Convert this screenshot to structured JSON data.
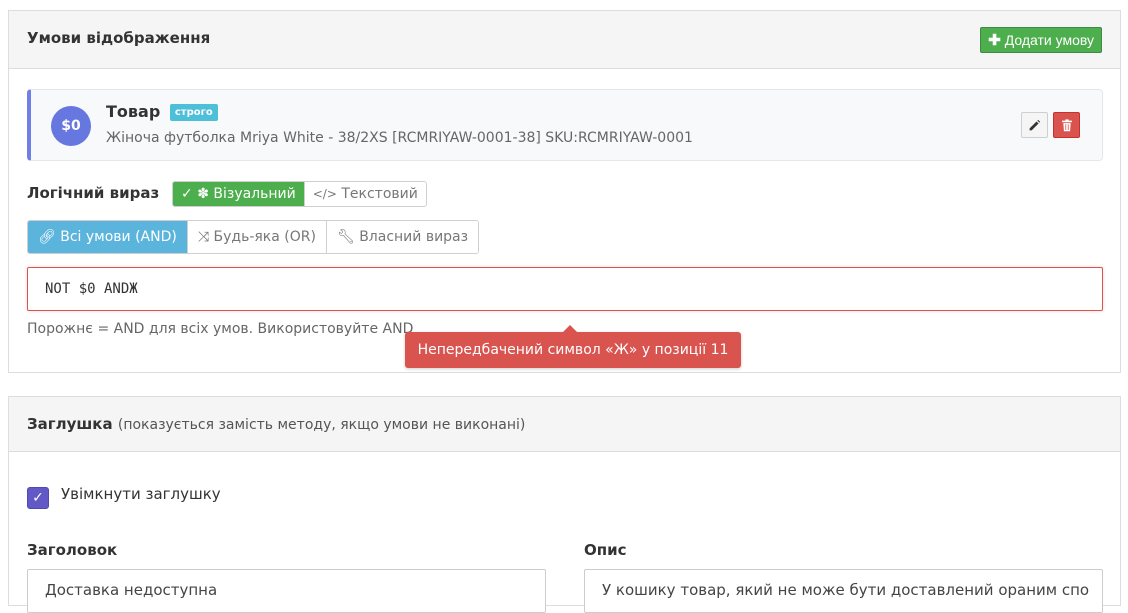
{
  "display_conditions": {
    "title": "Умови відображення",
    "add_button_label": "Додати умову",
    "condition": {
      "badge": "$0",
      "name": "Товар",
      "tag": "строго",
      "description": "Жіноча футболка Mriya White - 38/2XS [RCMRIYAW-0001-38] SKU:RCMRIYAW-0001",
      "edit_icon": "pencil-icon",
      "delete_icon": "trash-icon"
    },
    "logic": {
      "label": "Логічний вираз",
      "modes": [
        "Візуальний",
        "Текстовий"
      ],
      "active_mode": "Візуальний",
      "operators": [
        "Всі умови (AND)",
        "Будь-яка (OR)",
        "Власний вираз"
      ],
      "active_operator": "Всі умови (AND)",
      "expression": "NOT $0 ANDЖ",
      "hint": "Порожнє = AND для всіх умов. Використовуйте AND",
      "error": "Непередбачений символ «Ж» у позиції 11"
    }
  },
  "placeholder": {
    "title": "Заглушка",
    "subtitle": "(показується замість методу, якщо умови не виконані)",
    "enable_label": "Увімкнути заглушку",
    "enable_checked": true,
    "heading_label": "Заголовок",
    "heading_value": "Доставка недоступна",
    "description_label": "Опис",
    "description_value": "У кошику товар, який не може бути доставлений ораним спо"
  },
  "colors": {
    "success": "#4cae4c",
    "danger": "#d9534f",
    "info": "#5bb4dc",
    "accent": "#6677e0"
  }
}
